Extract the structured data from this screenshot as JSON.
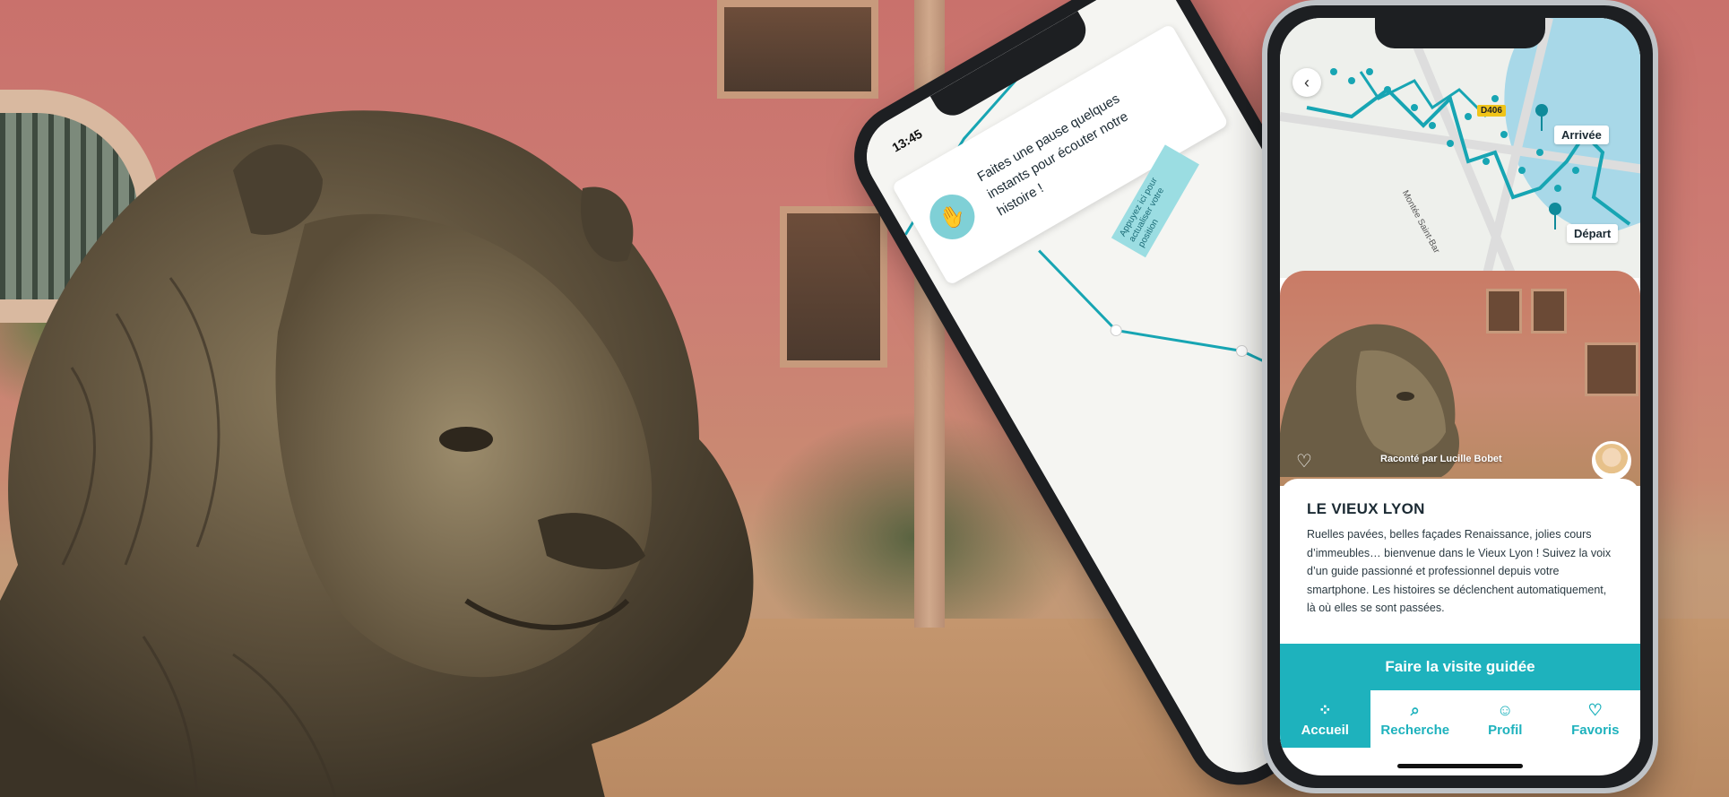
{
  "back_phone": {
    "time": "13:45",
    "notification_text": "Faites une pause quelques instants pour écouter notre histoire !",
    "refresh_tag": "Appuyez ici pour actualiser votre position",
    "hand_icon": "hand-icon"
  },
  "front_phone": {
    "map": {
      "back_icon": "chevron-left-icon",
      "road_badge": "D406",
      "arrival_label": "Arrivée",
      "departure_label": "Départ",
      "street_label": "Montée Saint-Bar"
    },
    "card": {
      "narrator": "Raconté par Lucille Bobet",
      "favorite_icon": "heart-outline-icon"
    },
    "title": "LE VIEUX LYON",
    "description": "Ruelles pavées, belles façades Renaissance, jolies cours d’immeubles… bienvenue dans le Vieux Lyon ! Suivez la voix d’un guide passionné et professionnel depuis votre smartphone. Les histoires se déclenchent automatiquement, là où elles se sont passées.",
    "cta_label": "Faire la visite guidée",
    "tabs": [
      {
        "label": "Accueil",
        "icon": "grid-icon"
      },
      {
        "label": "Recherche",
        "icon": "search-icon"
      },
      {
        "label": "Profil",
        "icon": "user-icon"
      },
      {
        "label": "Favoris",
        "icon": "heart-icon"
      }
    ]
  },
  "colors": {
    "accent": "#1eb2bd",
    "route": "#17a5b3",
    "pin": "#0f8a9a"
  }
}
